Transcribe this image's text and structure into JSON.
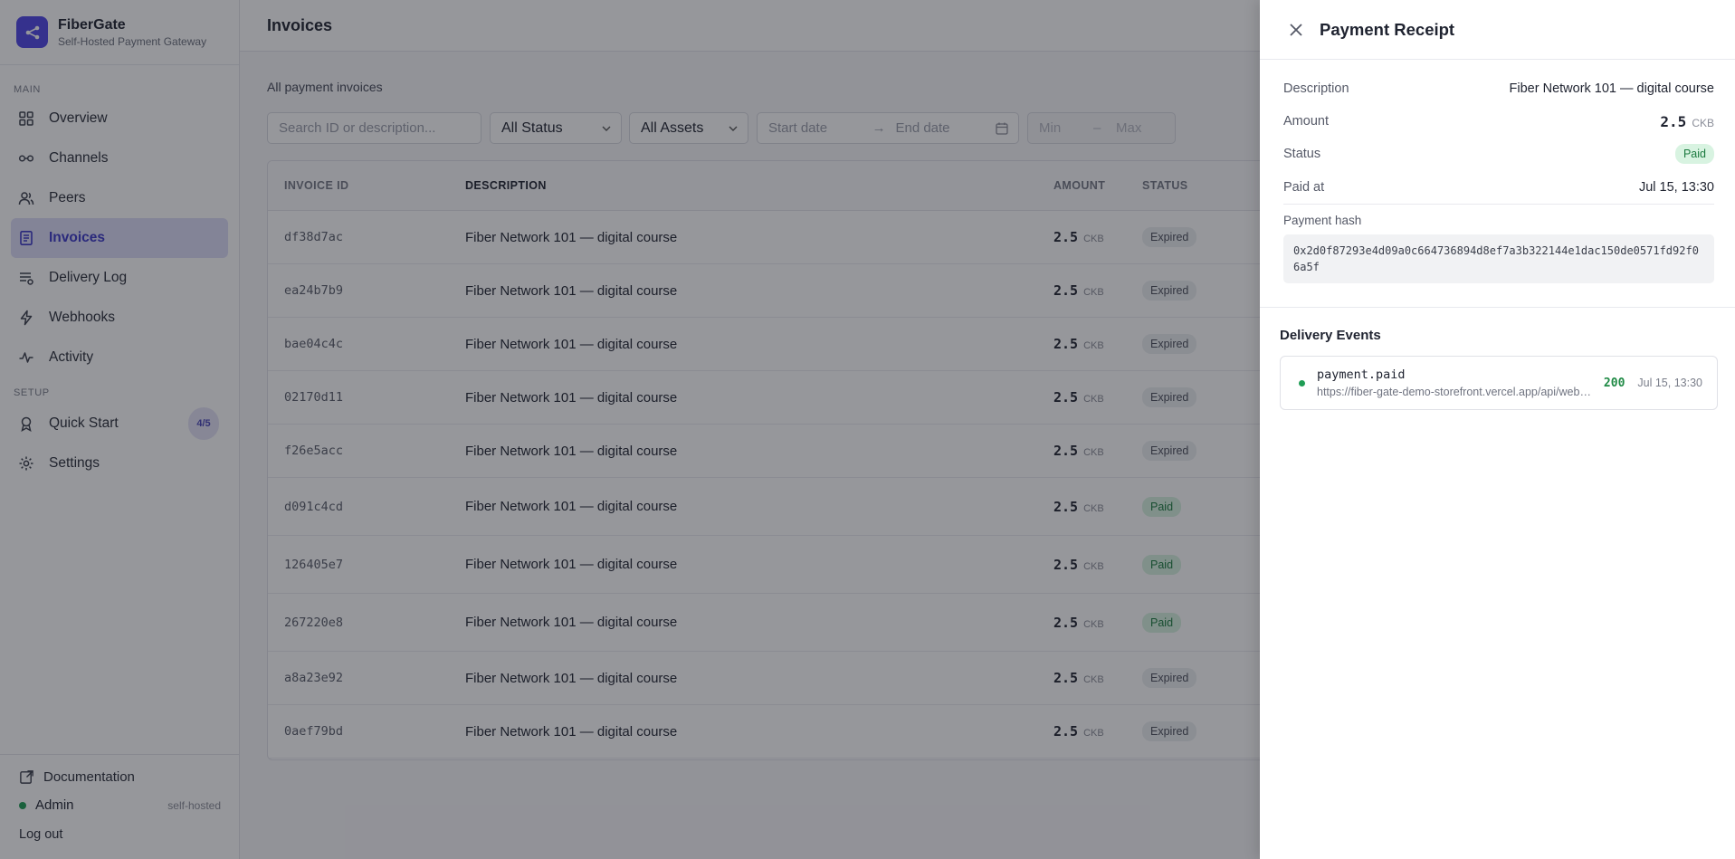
{
  "app": {
    "name": "FiberGate",
    "tagline": "Self-Hosted Payment Gateway"
  },
  "sidebar": {
    "main_label": "MAIN",
    "setup_label": "SETUP",
    "main_items": [
      {
        "label": "Overview",
        "icon": "grid-icon"
      },
      {
        "label": "Channels",
        "icon": "channel-link-icon"
      },
      {
        "label": "Peers",
        "icon": "users-icon"
      },
      {
        "label": "Invoices",
        "icon": "invoice-icon",
        "active": true
      },
      {
        "label": "Delivery Log",
        "icon": "list-icon"
      },
      {
        "label": "Webhooks",
        "icon": "bolt-icon"
      },
      {
        "label": "Activity",
        "icon": "pulse-icon"
      }
    ],
    "setup_items": [
      {
        "label": "Quick Start",
        "icon": "rocket-icon",
        "badge": "4/5"
      },
      {
        "label": "Settings",
        "icon": "gear-icon"
      }
    ],
    "footer": {
      "docs": "Documentation",
      "user": "Admin",
      "user_tag": "self-hosted",
      "logout": "Log out"
    }
  },
  "main": {
    "title": "Invoices",
    "subtitle": "All payment invoices",
    "filters": {
      "search_placeholder": "Search ID or description...",
      "status": "All Status",
      "assets": "All Assets",
      "start_date": "Start date",
      "end_date": "End date",
      "min": "Min",
      "max": "Max"
    },
    "columns": [
      "INVOICE ID",
      "DESCRIPTION",
      "AMOUNT",
      "STATUS"
    ],
    "rows": [
      {
        "id": "df38d7ac",
        "desc": "Fiber Network 101 — digital course",
        "amount": "2.5",
        "asset": "CKB",
        "status": "Expired"
      },
      {
        "id": "ea24b7b9",
        "desc": "Fiber Network 101 — digital course",
        "amount": "2.5",
        "asset": "CKB",
        "status": "Expired"
      },
      {
        "id": "bae04c4c",
        "desc": "Fiber Network 101 — digital course",
        "amount": "2.5",
        "asset": "CKB",
        "status": "Expired"
      },
      {
        "id": "02170d11",
        "desc": "Fiber Network 101 — digital course",
        "amount": "2.5",
        "asset": "CKB",
        "status": "Expired"
      },
      {
        "id": "f26e5acc",
        "desc": "Fiber Network 101 — digital course",
        "amount": "2.5",
        "asset": "CKB",
        "status": "Expired"
      },
      {
        "id": "d091c4cd",
        "desc": "Fiber Network 101 — digital course",
        "amount": "2.5",
        "asset": "CKB",
        "status": "Paid"
      },
      {
        "id": "126405e7",
        "desc": "Fiber Network 101 — digital course",
        "amount": "2.5",
        "asset": "CKB",
        "status": "Paid"
      },
      {
        "id": "267220e8",
        "desc": "Fiber Network 101 — digital course",
        "amount": "2.5",
        "asset": "CKB",
        "status": "Paid"
      },
      {
        "id": "a8a23e92",
        "desc": "Fiber Network 101 — digital course",
        "amount": "2.5",
        "asset": "CKB",
        "status": "Expired"
      },
      {
        "id": "0aef79bd",
        "desc": "Fiber Network 101 — digital course",
        "amount": "2.5",
        "asset": "CKB",
        "status": "Expired"
      }
    ]
  },
  "receipt": {
    "title": "Payment Receipt",
    "description_label": "Description",
    "description": "Fiber Network 101 — digital course",
    "amount_label": "Amount",
    "amount": "2.5",
    "asset": "CKB",
    "status_label": "Status",
    "status": "Paid",
    "paid_at_label": "Paid at",
    "paid_at": "Jul 15, 13:30",
    "hash_label": "Payment hash",
    "hash": "0x2d0f87293e4d09a0c664736894d8ef7a3b322144e1dac150de0571fd92f06a5f",
    "delivery_title": "Delivery Events",
    "events": [
      {
        "name": "payment.paid",
        "url": "https://fiber-gate-demo-storefront.vercel.app/api/webhooks",
        "code": "200",
        "time": "Jul 15, 13:30"
      }
    ]
  }
}
